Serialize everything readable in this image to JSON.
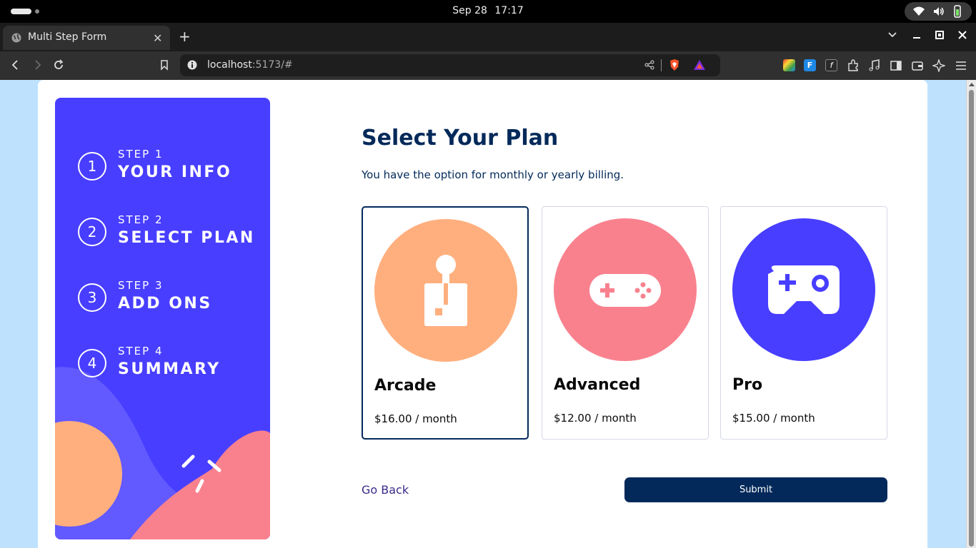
{
  "os": {
    "date": "Sep 28",
    "time": "17:17"
  },
  "browser": {
    "tab_title": "Multi Step Form",
    "url_host": "localhost",
    "url_rest": ":5173/#"
  },
  "sidebar": {
    "steps": [
      {
        "number": "1",
        "label": "STEP 1",
        "title": "YOUR INFO"
      },
      {
        "number": "2",
        "label": "STEP 2",
        "title": "SELECT PLAN"
      },
      {
        "number": "3",
        "label": "STEP 3",
        "title": "ADD ONS"
      },
      {
        "number": "4",
        "label": "STEP 4",
        "title": "SUMMARY"
      }
    ]
  },
  "main": {
    "title": "Select Your Plan",
    "subtitle": "You have the option for monthly or yearly billing.",
    "plans": [
      {
        "name": "Arcade",
        "price": "$16.00 / month",
        "icon": "arcade-joystick-icon",
        "color": "#ffaf7e",
        "selected": true
      },
      {
        "name": "Advanced",
        "price": "$12.00 / month",
        "icon": "gamepad-icon",
        "color": "#f9818e",
        "selected": false
      },
      {
        "name": "Pro",
        "price": "$15.00 / month",
        "icon": "controller-icon",
        "color": "#483eff",
        "selected": false
      }
    ],
    "go_back_label": "Go Back",
    "submit_label": "Submit"
  },
  "colors": {
    "accent": "#483eff",
    "marine_blue": "#02295a",
    "page_bg": "#bee2fd"
  }
}
